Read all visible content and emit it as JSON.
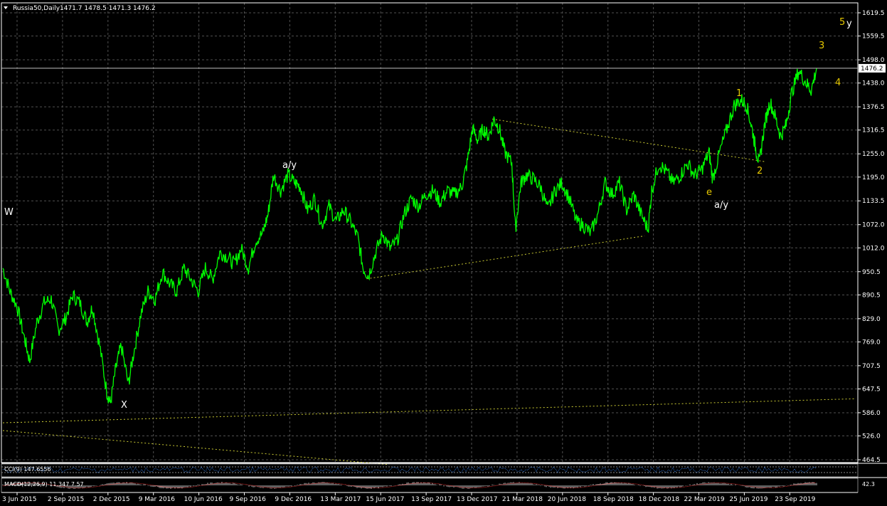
{
  "header": {
    "symbol": "Russia50,Daily",
    "ohlc": "1471.7 1478.5 1471.3 1476.2",
    "collapse_icon": "triangle-down-icon"
  },
  "colors": {
    "background": "#000000",
    "price": "#00ff00",
    "grid": "#505050",
    "trendline": "#c8c832",
    "white_label": "#ffffff",
    "yellow_label": "#e6c800"
  },
  "chart_data": [
    {
      "type": "line",
      "name": "price",
      "ylim": [
        464.5,
        1649.0
      ],
      "yticks": [
        "1619.5",
        "1559.5",
        "1498.0",
        "1438.0",
        "1376.5",
        "1316.5",
        "1255.0",
        "1195.0",
        "1133.5",
        "1072.0",
        "1012.0",
        "950.5",
        "890.5",
        "829.0",
        "769.0",
        "707.5",
        "647.5",
        "586.0",
        "526.0",
        "464.5"
      ],
      "xticks": [
        "3 Jun 2015",
        "2 Sep 2015",
        "2 Dec 2015",
        "9 Mar 2016",
        "10 Jun 2016",
        "9 Sep 2016",
        "9 Dec 2016",
        "13 Mar 2017",
        "15 Jun 2017",
        "13 Sep 2017",
        "13 Dec 2017",
        "21 Mar 2018",
        "20 Jun 2018",
        "18 Sep 2018",
        "18 Dec 2018",
        "22 Mar 2019",
        "25 Jun 2019",
        "23 Sep 2019"
      ],
      "current_price": "1476.2",
      "x": [
        0,
        3,
        6,
        9,
        12,
        15,
        18,
        21,
        24,
        27,
        30,
        33,
        36,
        39,
        42,
        45,
        48,
        51,
        54,
        57,
        60,
        63,
        66,
        69,
        72,
        75,
        78
      ],
      "y": [
        960,
        880,
        815,
        760,
        860,
        880,
        700,
        620,
        840,
        900,
        1000,
        970,
        1040,
        1070,
        1170,
        1195,
        1100,
        1140,
        1100,
        1035,
        940,
        1015,
        1020,
        1150,
        1100,
        1175,
        1170
      ],
      "points": [
        [
          0,
          960
        ],
        [
          0.4,
          900
        ],
        [
          0.8,
          860
        ],
        [
          1.2,
          780
        ],
        [
          1.5,
          720
        ],
        [
          1.9,
          820
        ],
        [
          2.3,
          870
        ],
        [
          2.7,
          880
        ],
        [
          3.1,
          800
        ],
        [
          3.5,
          830
        ],
        [
          3.9,
          890
        ],
        [
          4.3,
          870
        ],
        [
          4.7,
          820
        ],
        [
          5.0,
          860
        ],
        [
          5.4,
          760
        ],
        [
          5.8,
          640
        ],
        [
          6.0,
          610
        ],
        [
          6.3,
          700
        ],
        [
          6.6,
          760
        ],
        [
          7.0,
          660
        ],
        [
          7.3,
          740
        ],
        [
          7.7,
          840
        ],
        [
          8.1,
          900
        ],
        [
          8.5,
          880
        ],
        [
          8.9,
          950
        ],
        [
          9.3,
          920
        ],
        [
          9.7,
          900
        ],
        [
          10.1,
          960
        ],
        [
          10.5,
          930
        ],
        [
          10.9,
          900
        ],
        [
          11.3,
          960
        ],
        [
          11.7,
          930
        ],
        [
          12.1,
          1000
        ],
        [
          12.5,
          990
        ],
        [
          12.9,
          970
        ],
        [
          13.3,
          1010
        ],
        [
          13.7,
          960
        ],
        [
          14.1,
          1030
        ],
        [
          14.5,
          1050
        ],
        [
          14.8,
          1100
        ],
        [
          15.1,
          1200
        ],
        [
          15.5,
          1160
        ],
        [
          15.9,
          1200
        ],
        [
          16.3,
          1180
        ],
        [
          16.6,
          1170
        ],
        [
          17.0,
          1110
        ],
        [
          17.4,
          1140
        ],
        [
          17.8,
          1070
        ],
        [
          18.2,
          1120
        ],
        [
          18.6,
          1080
        ],
        [
          19.0,
          1110
        ],
        [
          19.4,
          1080
        ],
        [
          19.8,
          1040
        ],
        [
          20.1,
          960
        ],
        [
          20.4,
          940
        ],
        [
          20.8,
          1000
        ],
        [
          21.2,
          1050
        ],
        [
          21.6,
          1010
        ],
        [
          22.0,
          1030
        ],
        [
          22.4,
          1100
        ],
        [
          22.8,
          1140
        ],
        [
          23.2,
          1120
        ],
        [
          23.6,
          1150
        ],
        [
          24.0,
          1160
        ],
        [
          24.4,
          1130
        ],
        [
          24.8,
          1160
        ],
        [
          25.2,
          1150
        ],
        [
          25.6,
          1170
        ],
        [
          25.9,
          1230
        ],
        [
          26.2,
          1320
        ],
        [
          26.5,
          1290
        ],
        [
          26.8,
          1320
        ],
        [
          27.1,
          1300
        ],
        [
          27.4,
          1345
        ],
        [
          27.7,
          1320
        ],
        [
          28.0,
          1260
        ],
        [
          28.4,
          1230
        ],
        [
          28.6,
          1060
        ],
        [
          28.9,
          1180
        ],
        [
          29.2,
          1200
        ],
        [
          29.6,
          1190
        ],
        [
          30.0,
          1170
        ],
        [
          30.4,
          1110
        ],
        [
          30.8,
          1160
        ],
        [
          31.2,
          1180
        ],
        [
          31.6,
          1140
        ],
        [
          32.0,
          1080
        ],
        [
          32.4,
          1070
        ],
        [
          32.8,
          1050
        ],
        [
          33.2,
          1100
        ],
        [
          33.6,
          1180
        ],
        [
          34.0,
          1150
        ],
        [
          34.4,
          1180
        ],
        [
          34.8,
          1110
        ],
        [
          35.2,
          1150
        ],
        [
          35.6,
          1100
        ],
        [
          36.0,
          1060
        ],
        [
          36.2,
          1160
        ],
        [
          36.6,
          1230
        ],
        [
          37.0,
          1210
        ],
        [
          37.4,
          1180
        ],
        [
          37.8,
          1200
        ],
        [
          38.2,
          1230
        ],
        [
          38.6,
          1200
        ],
        [
          39.0,
          1215
        ],
        [
          39.4,
          1260
        ],
        [
          39.6,
          1190
        ],
        [
          40.0,
          1260
        ],
        [
          40.4,
          1320
        ],
        [
          40.8,
          1380
        ],
        [
          41.2,
          1395
        ],
        [
          41.5,
          1380
        ],
        [
          41.8,
          1320
        ],
        [
          42.0,
          1270
        ],
        [
          42.2,
          1230
        ],
        [
          42.5,
          1330
        ],
        [
          42.8,
          1390
        ],
        [
          43.1,
          1350
        ],
        [
          43.4,
          1300
        ],
        [
          43.7,
          1330
        ],
        [
          44.0,
          1410
        ],
        [
          44.4,
          1470
        ],
        [
          44.8,
          1440
        ],
        [
          45.1,
          1420
        ],
        [
          45.4,
          1476
        ]
      ],
      "series": [
        {
          "name": "Russia50,Daily"
        }
      ],
      "trendlines": [
        {
          "from": [
            20.3,
            932
          ],
          "to": [
            35.8,
            1043
          ]
        },
        {
          "from": [
            27.3,
            1345
          ],
          "to": [
            42.5,
            1235
          ]
        },
        {
          "from": [
            0,
            560
          ],
          "to": [
            47.5,
            622
          ]
        },
        {
          "from": [
            0,
            540
          ],
          "to": [
            21.5,
            452
          ]
        }
      ]
    },
    {
      "type": "line",
      "name": "CCI",
      "label": "CCI(9) 147.6556"
    },
    {
      "type": "area",
      "name": "MACD",
      "label": "MACD(12,26,9) 11.347 7.57",
      "right_value": "42.3"
    }
  ],
  "annotations": [
    {
      "text": "W",
      "color": "white"
    },
    {
      "text": "X",
      "color": "white"
    },
    {
      "text": "a/y",
      "color": "white"
    },
    {
      "text": "e",
      "color": "yellow"
    },
    {
      "text": "a/y",
      "color": "white"
    },
    {
      "text": "1",
      "color": "yellow"
    },
    {
      "text": "2",
      "color": "yellow"
    },
    {
      "text": "3",
      "color": "yellow"
    },
    {
      "text": "4",
      "color": "yellow"
    },
    {
      "text": "5",
      "color": "yellow"
    },
    {
      "text": "y",
      "color": "white"
    }
  ]
}
